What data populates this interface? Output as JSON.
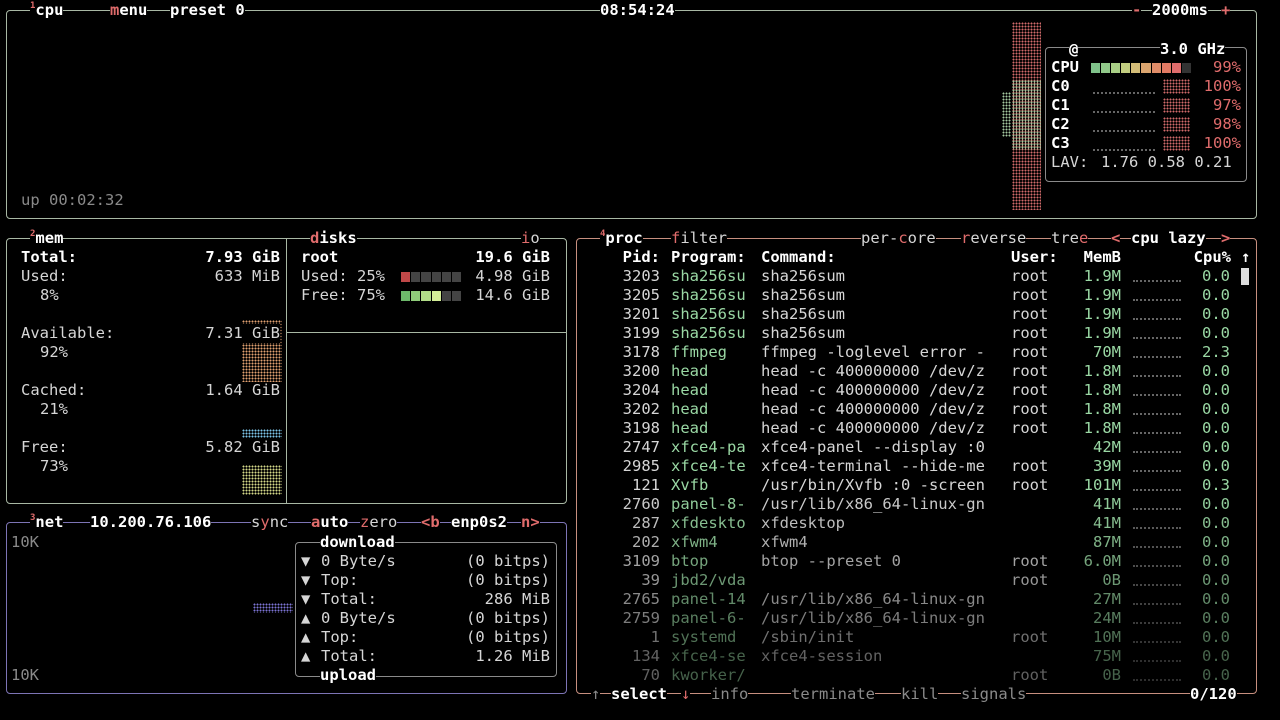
{
  "cpu": {
    "title": "cpu",
    "title_num": "1",
    "menu": "menu",
    "preset": "preset 0",
    "clock": "08:54:24",
    "interval": "2000ms",
    "interval_minus": "-",
    "interval_plus": "+",
    "uptime": "up 00:02:32",
    "freq_at": "@",
    "freq": "3.0 GHz",
    "rows": [
      {
        "label": "CPU",
        "pct": "99%"
      },
      {
        "label": "C0",
        "pct": "100%"
      },
      {
        "label": "C1",
        "pct": "97%"
      },
      {
        "label": "C2",
        "pct": "98%"
      },
      {
        "label": "C3",
        "pct": "100%"
      }
    ],
    "lav_label": "LAV:",
    "lav": "1.76 0.58 0.21"
  },
  "mem": {
    "title": "mem",
    "title_num": "2",
    "total_label": "Total:",
    "total": "7.93 GiB",
    "used_label": "Used:",
    "used": "633 MiB",
    "used_pct": "8%",
    "avail_label": "Available:",
    "avail": "7.31 GiB",
    "avail_pct": "92%",
    "cached_label": "Cached:",
    "cached": "1.64 GiB",
    "cached_pct": "21%",
    "free_label": "Free:",
    "free": "5.82 GiB",
    "free_pct": "73%"
  },
  "disks": {
    "title": "disks",
    "io": "io",
    "name": "root",
    "size": "19.6 GiB",
    "used_label": "Used: 25%",
    "used": "4.98 GiB",
    "free_label": "Free: 75%",
    "free": "14.6 GiB"
  },
  "net": {
    "title": "net",
    "title_num": "3",
    "ip": "10.200.76.106",
    "sync": "sync",
    "auto": "auto",
    "zero": "zero",
    "iface_prev": "<b",
    "iface": "enp0s2",
    "iface_next": "n>",
    "scale_top": "10K",
    "scale_bottom": "10K",
    "download_label": "download",
    "upload_label": "upload",
    "rows": [
      {
        "arrow": "▼",
        "label": "0 Byte/s",
        "value": "(0 bitps)"
      },
      {
        "arrow": "▼",
        "label": "Top:",
        "value": "(0 bitps)"
      },
      {
        "arrow": "▼",
        "label": "Total:",
        "value": "286 MiB"
      },
      {
        "arrow": "▲",
        "label": "0 Byte/s",
        "value": "(0 bitps)"
      },
      {
        "arrow": "▲",
        "label": "Top:",
        "value": "(0 bitps)"
      },
      {
        "arrow": "▲",
        "label": "Total:",
        "value": "1.26 MiB"
      }
    ]
  },
  "proc": {
    "title": "proc",
    "title_num": "4",
    "filter": "filter",
    "per_core": "per-core",
    "reverse": "reverse",
    "tree": "tree",
    "sort_prev": "<",
    "sort": "cpu lazy",
    "sort_next": ">",
    "headers": {
      "pid": "Pid:",
      "program": "Program:",
      "command": "Command:",
      "user": "User:",
      "mem": "MemB",
      "cpu": "Cpu%",
      "scroll": "↑"
    },
    "rows": [
      {
        "pid": "3203",
        "program": "sha256su",
        "command": "sha256sum",
        "user": "root",
        "mem": "1.9M",
        "cpu": "0.0"
      },
      {
        "pid": "3205",
        "program": "sha256su",
        "command": "sha256sum",
        "user": "root",
        "mem": "1.9M",
        "cpu": "0.0"
      },
      {
        "pid": "3201",
        "program": "sha256su",
        "command": "sha256sum",
        "user": "root",
        "mem": "1.9M",
        "cpu": "0.0"
      },
      {
        "pid": "3199",
        "program": "sha256su",
        "command": "sha256sum",
        "user": "root",
        "mem": "1.9M",
        "cpu": "0.0"
      },
      {
        "pid": "3178",
        "program": "ffmpeg",
        "command": "ffmpeg -loglevel error -",
        "user": "root",
        "mem": "70M",
        "cpu": "2.3"
      },
      {
        "pid": "3200",
        "program": "head",
        "command": "head -c 400000000 /dev/z",
        "user": "root",
        "mem": "1.8M",
        "cpu": "0.0"
      },
      {
        "pid": "3204",
        "program": "head",
        "command": "head -c 400000000 /dev/z",
        "user": "root",
        "mem": "1.8M",
        "cpu": "0.0"
      },
      {
        "pid": "3202",
        "program": "head",
        "command": "head -c 400000000 /dev/z",
        "user": "root",
        "mem": "1.8M",
        "cpu": "0.0"
      },
      {
        "pid": "3198",
        "program": "head",
        "command": "head -c 400000000 /dev/z",
        "user": "root",
        "mem": "1.8M",
        "cpu": "0.0"
      },
      {
        "pid": "2747",
        "program": "xfce4-pa",
        "command": "xfce4-panel --display :0",
        "user": "",
        "mem": "42M",
        "cpu": "0.0"
      },
      {
        "pid": "2985",
        "program": "xfce4-te",
        "command": "xfce4-terminal --hide-me",
        "user": "root",
        "mem": "39M",
        "cpu": "0.0"
      },
      {
        "pid": "121",
        "program": "Xvfb",
        "command": "/usr/bin/Xvfb :0 -screen",
        "user": "root",
        "mem": "101M",
        "cpu": "0.3"
      },
      {
        "pid": "2760",
        "program": "panel-8-",
        "command": "/usr/lib/x86_64-linux-gn",
        "user": "",
        "mem": "41M",
        "cpu": "0.0"
      },
      {
        "pid": "287",
        "program": "xfdeskto",
        "command": "xfdesktop",
        "user": "",
        "mem": "41M",
        "cpu": "0.0"
      },
      {
        "pid": "202",
        "program": "xfwm4",
        "command": "xfwm4",
        "user": "",
        "mem": "87M",
        "cpu": "0.0"
      },
      {
        "pid": "3109",
        "program": "btop",
        "command": "btop --preset 0",
        "user": "root",
        "mem": "6.0M",
        "cpu": "0.0"
      },
      {
        "pid": "39",
        "program": "jbd2/vda",
        "command": "",
        "user": "root",
        "mem": "0B",
        "cpu": "0.0"
      },
      {
        "pid": "2765",
        "program": "panel-14",
        "command": "/usr/lib/x86_64-linux-gn",
        "user": "",
        "mem": "27M",
        "cpu": "0.0"
      },
      {
        "pid": "2759",
        "program": "panel-6-",
        "command": "/usr/lib/x86_64-linux-gn",
        "user": "",
        "mem": "24M",
        "cpu": "0.0"
      },
      {
        "pid": "1",
        "program": "systemd",
        "command": "/sbin/init",
        "user": "root",
        "mem": "10M",
        "cpu": "0.0"
      },
      {
        "pid": "134",
        "program": "xfce4-se",
        "command": "xfce4-session",
        "user": "",
        "mem": "75M",
        "cpu": "0.0"
      },
      {
        "pid": "70",
        "program": "kworker/",
        "command": "",
        "user": "root",
        "mem": "0B",
        "cpu": "0.0"
      }
    ],
    "footer": {
      "up": "↑",
      "select": "select",
      "down": "↓",
      "info": "info",
      "terminate": "terminate",
      "kill": "kill",
      "signals": "signals",
      "count": "0/120"
    }
  },
  "colors": {
    "cpu_border": "#a8b7a4",
    "mem_border": "#a8b7a4",
    "net_border": "#7d74b5",
    "proc_border": "#c78f7f",
    "accent": "#e06c6c",
    "green": "#9ad8a4"
  }
}
